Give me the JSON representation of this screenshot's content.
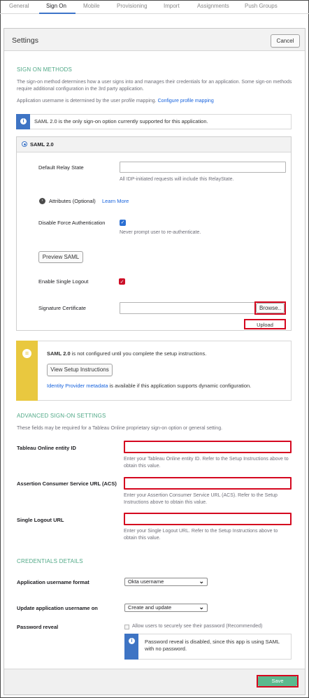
{
  "tabs": [
    {
      "label": "General"
    },
    {
      "label": "Sign On"
    },
    {
      "label": "Mobile"
    },
    {
      "label": "Provisioning"
    },
    {
      "label": "Import"
    },
    {
      "label": "Assignments"
    },
    {
      "label": "Push Groups"
    }
  ],
  "active_tab": "Sign On",
  "settings": {
    "title": "Settings",
    "cancel_label": "Cancel"
  },
  "sign_on": {
    "title": "SIGN ON METHODS",
    "desc": "The sign-on method determines how a user signs into and manages their credentials for an application. Some sign-on methods require additional configuration in the 3rd party application.",
    "mapping_text": "Application username is determined by the user profile mapping.",
    "mapping_link": "Configure profile mapping",
    "info_text": "SAML 2.0 is the only sign-on option currently supported for this application.",
    "method_label": "SAML 2.0",
    "relay_label": "Default Relay State",
    "relay_value": "",
    "relay_help": "All IDP-initiated requests will include this RelayState.",
    "attributes_label": "Attributes (Optional)",
    "learn_more": "Learn More",
    "force_auth_label": "Disable Force Authentication",
    "force_auth_help": "Never prompt user to re-authenticate.",
    "preview_label": "Preview SAML",
    "slo_label": "Enable Single Logout",
    "cert_label": "Signature Certificate",
    "browse_label": "Browse..",
    "upload_label": "Upload"
  },
  "setup_notice": {
    "strong": "SAML 2.0",
    "text": " is not configured until you complete the setup instructions.",
    "button": "View Setup Instructions",
    "metadata_link": "Identity Provider metadata",
    "metadata_text": " is available if this application supports dynamic configuration."
  },
  "advanced": {
    "title": "ADVANCED SIGN-ON SETTINGS",
    "desc": "These fields may be required for a Tableau Online proprietary sign-on option or general setting.",
    "entity_label": "Tableau Online entity ID",
    "entity_help": "Enter your Tableau Online entity ID. Refer to the Setup Instructions above to obtain this value.",
    "acs_label": "Assertion Consumer Service URL (ACS)",
    "acs_help": "Enter your Assertion Consumer Service URL (ACS). Refer to the Setup Instructions above to obtain this value.",
    "slo_label": "Single Logout URL",
    "slo_help": "Enter your Single Logout URL. Refer to the Setup Instructions above to obtain this value."
  },
  "credentials": {
    "title": "CREDENTIALS DETAILS",
    "format_label": "Application username format",
    "format_value": "Okta username",
    "update_label": "Update application username on",
    "update_value": "Create and update",
    "reveal_label": "Password reveal",
    "reveal_checkbox": "Allow users to securely see their password (Recommended)",
    "reveal_info": "Password reveal is disabled, since this app is using SAML with no password."
  },
  "footer": {
    "save_label": "Save"
  },
  "colors": {
    "accent_green": "#4fa886",
    "link_blue": "#1662dd",
    "info_blue": "#3e74c4",
    "warn_yellow": "#e9c83f",
    "highlight_red": "#d5071f",
    "save_green": "#5bb98e"
  }
}
